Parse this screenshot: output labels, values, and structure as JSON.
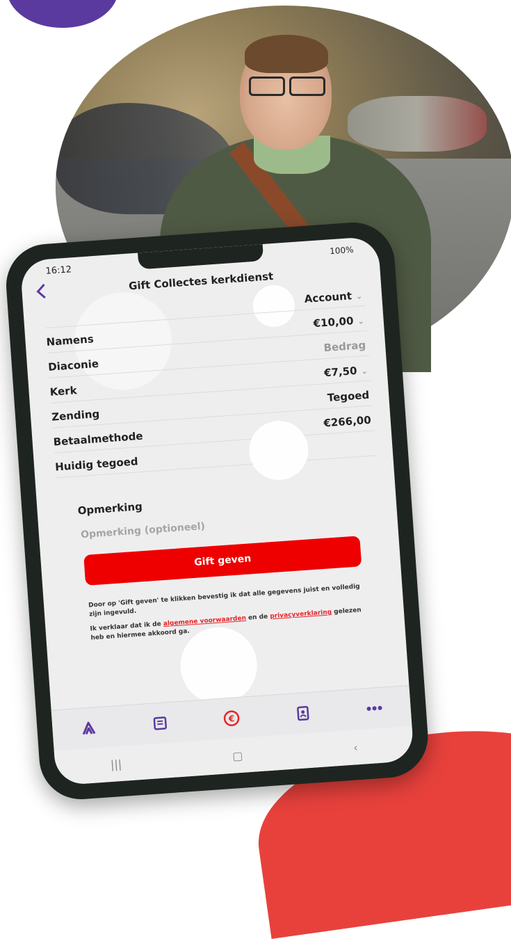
{
  "status": {
    "time": "16:12",
    "battery": "100%"
  },
  "header": {
    "title": "Gift Collectes kerkdienst"
  },
  "form": {
    "rows": [
      {
        "label": "",
        "value": "Account",
        "chevron": true,
        "muted": false
      },
      {
        "label": "Namens",
        "value": "€10,00",
        "chevron": true,
        "muted": false
      },
      {
        "label": "Diaconie",
        "value": "Bedrag",
        "chevron": false,
        "muted": true
      },
      {
        "label": "Kerk",
        "value": "€7,50",
        "chevron": true,
        "muted": false
      },
      {
        "label": "Zending",
        "value": "Tegoed",
        "chevron": false,
        "muted": false
      },
      {
        "label": "Betaalmethode",
        "value": "€266,00",
        "chevron": false,
        "muted": false
      },
      {
        "label": "Huidig tegoed",
        "value": "",
        "chevron": false,
        "muted": false
      }
    ],
    "remark_label": "Opmerking",
    "remark_placeholder": "Opmerking (optioneel)"
  },
  "submit_label": "Gift geven",
  "disclaimer": {
    "line1": "Door op 'Gift geven' te klikken bevestig ik dat alle gegevens juist en volledig zijn ingevuld.",
    "line2_prefix": "Ik verklaar dat ik de ",
    "terms_link": "algemene voorwaarden",
    "line2_middle": " en de ",
    "privacy_link": "privacyverklaring",
    "line2_suffix": " gelezen heb en hiermee akkoord ga."
  },
  "tabbar": {
    "items": [
      "home-icon",
      "news-icon",
      "euro-icon",
      "contacts-icon",
      "more-icon"
    ],
    "accent": "#5b3aa0",
    "euro_color": "#e3262a"
  },
  "colors": {
    "primary_red": "#ee0000",
    "brand_purple": "#5b3aa0",
    "blob_red": "#e8413c"
  }
}
